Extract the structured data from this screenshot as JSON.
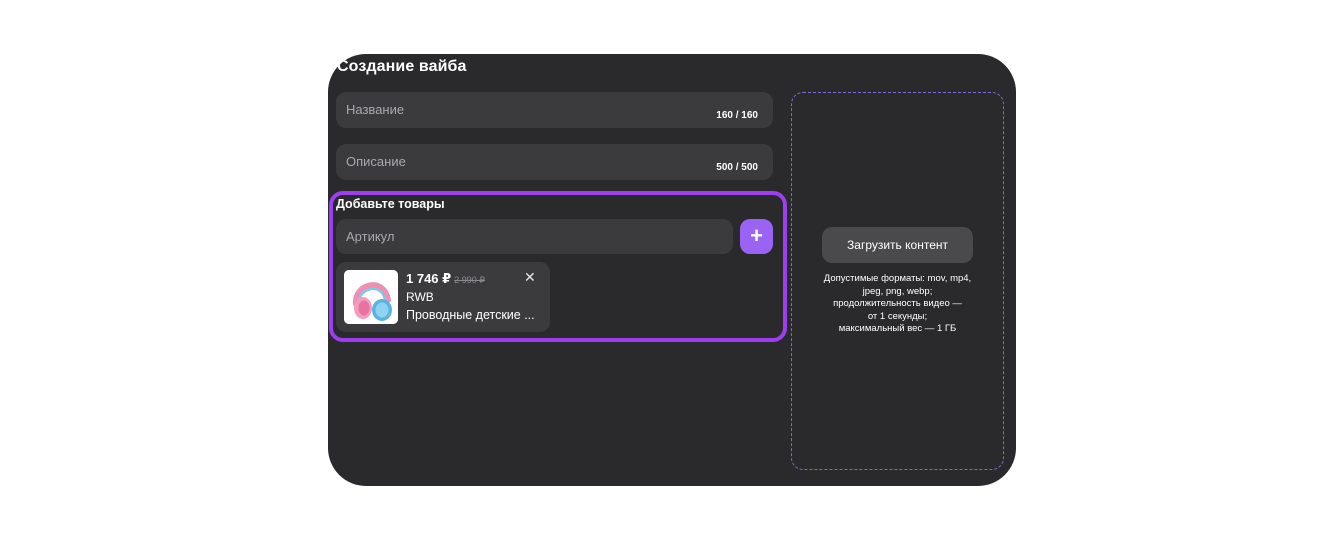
{
  "form": {
    "title": "Создание вайба",
    "name_placeholder": "Название",
    "name_counter": "160 / 160",
    "description_placeholder": "Описание",
    "description_counter": "500 / 500"
  },
  "goods": {
    "title": "Добавьте товары",
    "sku_placeholder": "Артикул",
    "add_button_icon": "plus-icon",
    "add_button_label": "+",
    "accent_color": "#9d3ff0",
    "product": {
      "price": "1 746 ₽",
      "old_price": "2 990 ₽",
      "brand": "RWB",
      "name": "Проводные детские ...",
      "close_icon": "close-icon",
      "close_label": "✕"
    }
  },
  "upload": {
    "button_label": "Загрузить контент",
    "hint_lines": [
      "Допустимые форматы: mov, mp4,",
      "jpeg, png, webp;",
      "продолжительность видео —",
      "от 1 секунды;",
      "максимальный вес — 1 ГБ"
    ]
  }
}
